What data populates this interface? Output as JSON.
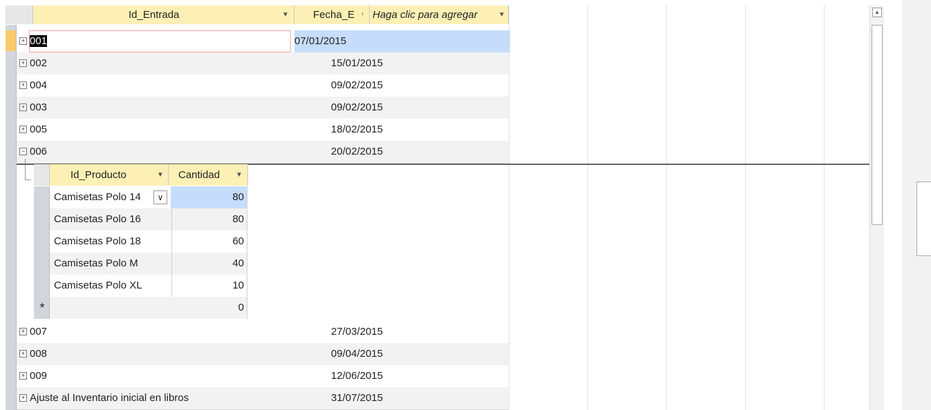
{
  "columns": {
    "id_entrada": "Id_Entrada",
    "fecha": "Fecha_E",
    "add": "Haga clic para agregar"
  },
  "rows": [
    {
      "id": "001",
      "date": "07/01/2015",
      "selected": true
    },
    {
      "id": "002",
      "date": "15/01/2015"
    },
    {
      "id": "004",
      "date": "09/02/2015"
    },
    {
      "id": "003",
      "date": "09/02/2015"
    },
    {
      "id": "005",
      "date": "18/02/2015"
    },
    {
      "id": "006",
      "date": "20/02/2015",
      "expanded": true
    },
    {
      "id": "007",
      "date": "27/03/2015"
    },
    {
      "id": "008",
      "date": "09/04/2015"
    },
    {
      "id": "009",
      "date": "12/06/2015"
    },
    {
      "id": "Ajuste al Inventario inicial en libros",
      "date": "31/07/2015"
    }
  ],
  "sub": {
    "headers": {
      "product": "Id_Producto",
      "qty": "Cantidad"
    },
    "rows": [
      {
        "product": "Camisetas Polo 14",
        "qty": "80"
      },
      {
        "product": "Camisetas Polo 16",
        "qty": "80"
      },
      {
        "product": "Camisetas Polo 18",
        "qty": "60"
      },
      {
        "product": "Camisetas Polo M",
        "qty": "40"
      },
      {
        "product": "Camisetas Polo XL",
        "qty": "10"
      }
    ],
    "new_row_marker": "*",
    "new_row_qty": "0"
  },
  "icons": {
    "expand": "plus-box-icon",
    "collapse": "minus-box-icon",
    "dropdown": "dropdown-arrow-icon",
    "sort": "sort-icon",
    "combo": "combo-arrow-icon",
    "new_record": "new-record-icon"
  },
  "colors": {
    "header_bg": "#fdf0b5",
    "selection_blue": "#c5ddfb",
    "current_row": "#f9c96c",
    "alt_row": "#f2f2f2"
  }
}
